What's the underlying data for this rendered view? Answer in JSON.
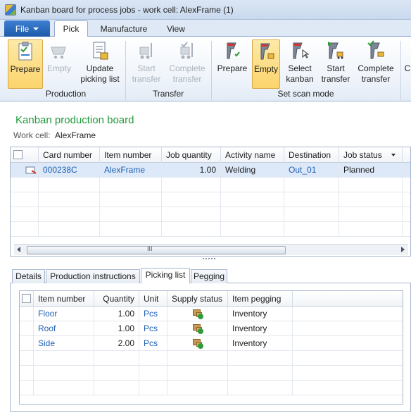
{
  "window": {
    "title": "Kanban board for process jobs - work cell: AlexFrame (1)"
  },
  "ribbon_tabs": {
    "file": "File",
    "pick": "Pick",
    "manufacture": "Manufacture",
    "view": "View"
  },
  "ribbon": {
    "production": {
      "label": "Production",
      "prepare": "Prepare",
      "empty": "Empty",
      "update_picking_1": "Update",
      "update_picking_2": "picking list"
    },
    "transfer": {
      "label": "Transfer",
      "start_1": "Start",
      "start_2": "transfer",
      "complete_1": "Complete",
      "complete_2": "transfer"
    },
    "scan_mode": {
      "label": "Set scan mode",
      "prepare": "Prepare",
      "empty": "Empty",
      "select_1": "Select",
      "select_2": "kanban",
      "start_1": "Start",
      "start_2": "transfer",
      "complete_1": "Complete",
      "complete_2": "transfer",
      "cut": "C"
    }
  },
  "board": {
    "title": "Kanban production board",
    "work_cell_label": "Work cell:",
    "work_cell_value": "AlexFrame"
  },
  "jobs_grid": {
    "headers": [
      "Card number",
      "Item number",
      "Job quantity",
      "Activity name",
      "Destination",
      "Job status"
    ],
    "rows": [
      {
        "card": "000238C",
        "item": "AlexFrame",
        "qty": "1.00",
        "activity": "Welding",
        "destination": "Out_01",
        "status": "Planned"
      }
    ]
  },
  "detail_tabs": {
    "details": "Details",
    "production_instructions": "Production instructions",
    "picking_list": "Picking list",
    "pegging": "Pegging"
  },
  "picking_grid": {
    "headers": [
      "Item number",
      "Quantity",
      "Unit",
      "Supply status",
      "Item pegging"
    ],
    "rows": [
      {
        "item": "Floor",
        "qty": "1.00",
        "unit": "Pcs",
        "pegging": "Inventory"
      },
      {
        "item": "Roof",
        "qty": "1.00",
        "unit": "Pcs",
        "pegging": "Inventory"
      },
      {
        "item": "Side",
        "qty": "2.00",
        "unit": "Pcs",
        "pegging": "Inventory"
      }
    ]
  },
  "scrollbar": {
    "grip": "III"
  }
}
